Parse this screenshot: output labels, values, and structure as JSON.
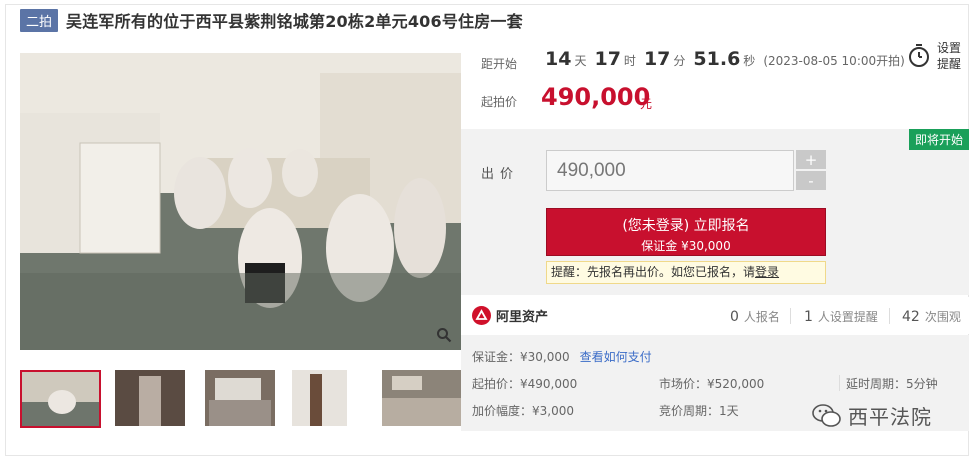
{
  "title": {
    "badge": "二拍",
    "text": "吴连军所有的位于西平县紫荆铭城第20栋2单元406号住房一套"
  },
  "countdown": {
    "label": "距开始",
    "days": "14",
    "days_unit": "天",
    "hours": "17",
    "hours_unit": "时",
    "minutes": "17",
    "minutes_unit": "分",
    "seconds": "51.6",
    "seconds_unit": "秒",
    "start_time": "(2023-08-05 10:00开拍)"
  },
  "reminder": {
    "label": "设置提醒",
    "icon": "alarm-clock-icon"
  },
  "start_price": {
    "label": "起拍价",
    "value": "490,000",
    "unit": "元"
  },
  "bid": {
    "status_tag": "即将开始",
    "label": "出价",
    "input_value": "490,000",
    "increase": "+",
    "decrease": "-",
    "signup_main": "(您未登录) 立即报名",
    "signup_deposit": "保证金 ¥30,000",
    "notice_prefix": "提醒：先报名再出价。如您已报名，请",
    "notice_link": "登录"
  },
  "platform": {
    "name": "阿里资产",
    "icon": "ali-asset-logo-icon"
  },
  "stats": [
    {
      "count": "0",
      "label": "人报名"
    },
    {
      "count": "1",
      "label": "人设置提醒"
    },
    {
      "count": "42",
      "label": "次围观"
    }
  ],
  "details": {
    "deposit": "保证金：¥30,000",
    "deposit_link": "查看如何支付",
    "start_price": "起拍价：¥490,000",
    "market_price": "市场价：¥520,000",
    "delay_period": "延时周期：5分钟",
    "increment": "加价幅度：¥3,000",
    "bid_period": "竞价周期：1天"
  },
  "watermark": {
    "text": "西平法院",
    "icon": "wechat-icon"
  },
  "gallery": {
    "zoom_icon": "magnifier-icon",
    "active_index": 0
  },
  "colors": {
    "accent_red": "#c8102e",
    "badge_blue": "#5b74a6",
    "status_green": "#1aa05a",
    "link_blue": "#3b6cc7"
  }
}
